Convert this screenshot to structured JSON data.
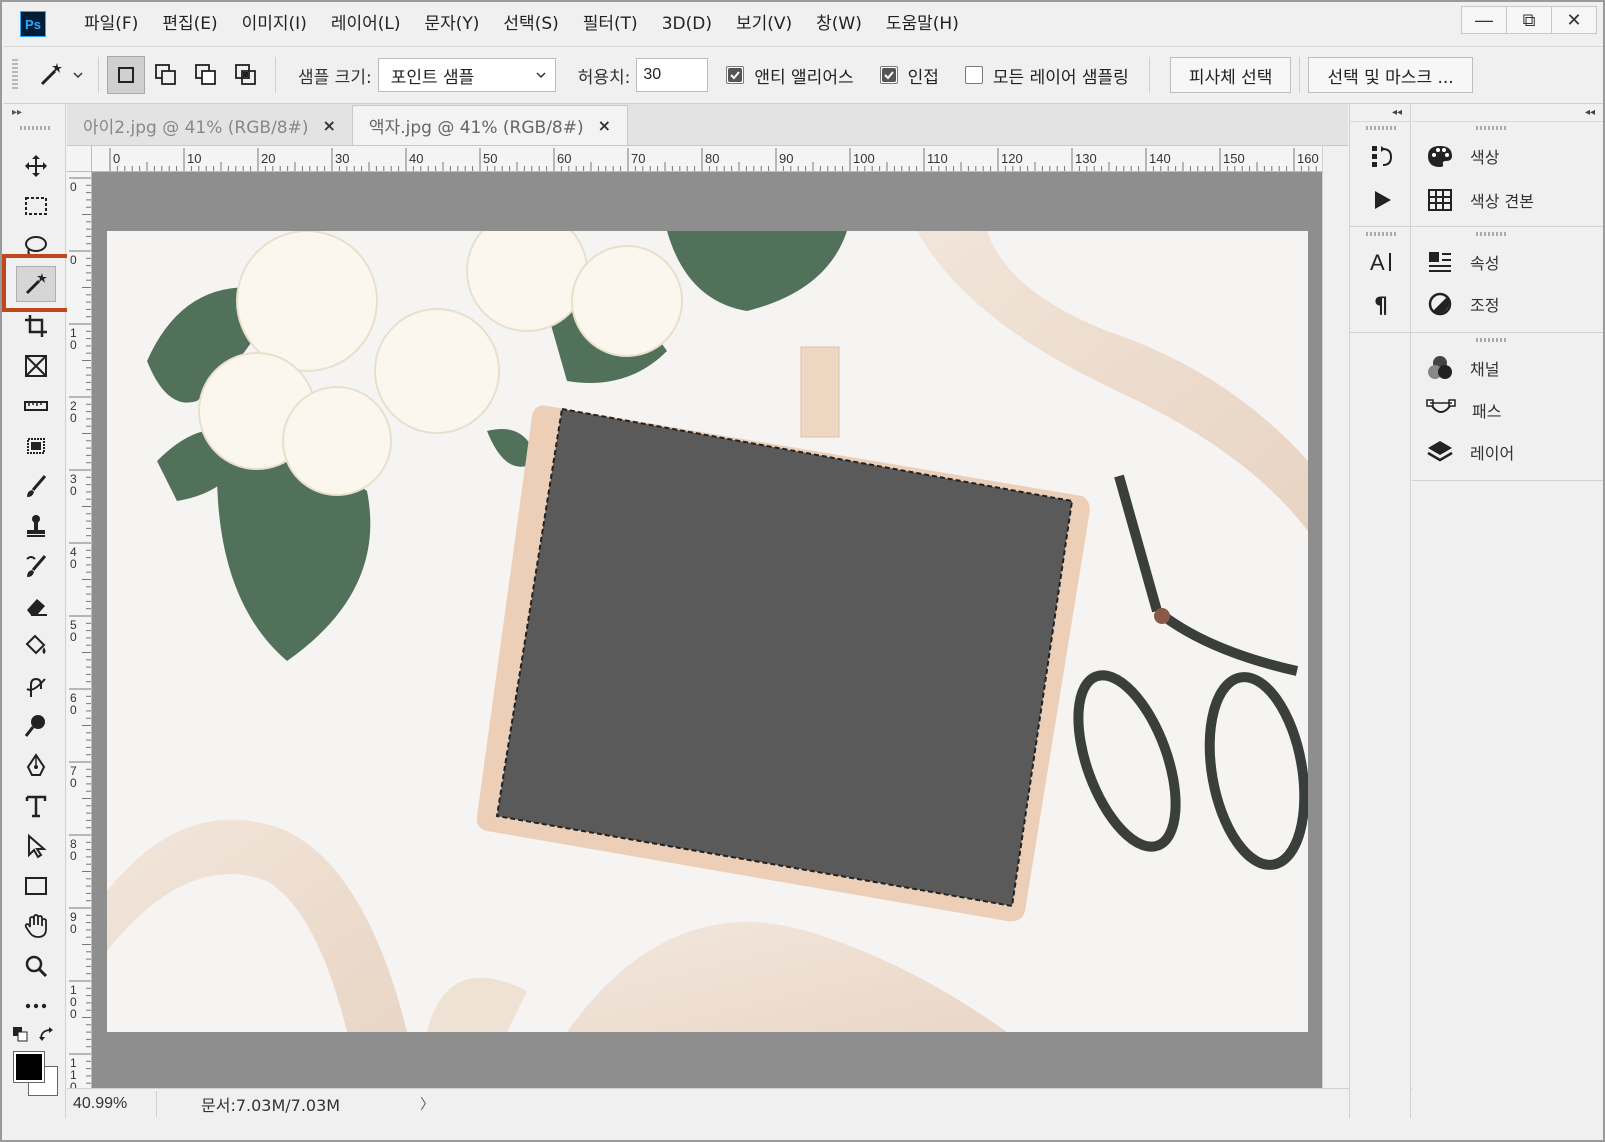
{
  "app": {
    "logo": "Ps"
  },
  "menu": [
    "파일(F)",
    "편집(E)",
    "이미지(I)",
    "레이어(L)",
    "문자(Y)",
    "선택(S)",
    "필터(T)",
    "3D(D)",
    "보기(V)",
    "창(W)",
    "도움말(H)"
  ],
  "window_controls": {
    "minimize": "—",
    "restore": "⧉",
    "close": "✕"
  },
  "options": {
    "sample_size_label": "샘플 크기:",
    "sample_size_value": "포인트 샘플",
    "tolerance_label": "허용치:",
    "tolerance_value": "30",
    "anti_alias_label": "앤티 앨리어스",
    "anti_alias_checked": true,
    "contiguous_label": "인접",
    "contiguous_checked": true,
    "sample_all_layers_label": "모든 레이어 샘플링",
    "sample_all_layers_checked": false,
    "subject_button": "피사체 선택",
    "select_mask_button": "선택 및 마스크 ..."
  },
  "tabs": [
    {
      "label": "아이2.jpg @ 41% (RGB/8#)",
      "active": false
    },
    {
      "label": "액자.jpg @ 41% (RGB/8#)",
      "active": true
    }
  ],
  "ruler_top_labels": [
    "0",
    "10",
    "20",
    "30",
    "40",
    "50",
    "60",
    "70",
    "80",
    "90",
    "100",
    "110",
    "120",
    "130",
    "140",
    "150",
    "160"
  ],
  "ruler_left_labels": [
    "0",
    "0",
    "1 0",
    "2 0",
    "3 0",
    "4 0",
    "5 0",
    "6 0",
    "7 0",
    "8 0",
    "9 0",
    "1 0 0",
    "1 1 0"
  ],
  "tools": [
    "move-tool",
    "marquee-tool",
    "lasso-tool",
    "magic-wand-tool",
    "crop-tool",
    "frame-tool",
    "ruler-tool",
    "patch-tool",
    "brush-tool",
    "clone-stamp-tool",
    "history-brush-tool",
    "eraser-tool",
    "paint-bucket-tool",
    "smudge-tool",
    "dodge-tool",
    "pen-tool",
    "type-tool",
    "path-selection-tool",
    "rectangle-tool",
    "hand-tool",
    "zoom-tool",
    "more-tools"
  ],
  "status": {
    "zoom": "40.99%",
    "doc_info": "문서:7.03M/7.03M",
    "arrow": "〉"
  },
  "panels": {
    "color": "색상",
    "swatches": "색상 견본",
    "properties": "속성",
    "adjustments": "조정",
    "channels": "채널",
    "paths": "패스",
    "layers": "레이어"
  },
  "colors": {
    "highlight": "#c0461b",
    "foreground": "#000000",
    "background": "#ffffff",
    "canvas_bg": "#8e8e8e"
  }
}
